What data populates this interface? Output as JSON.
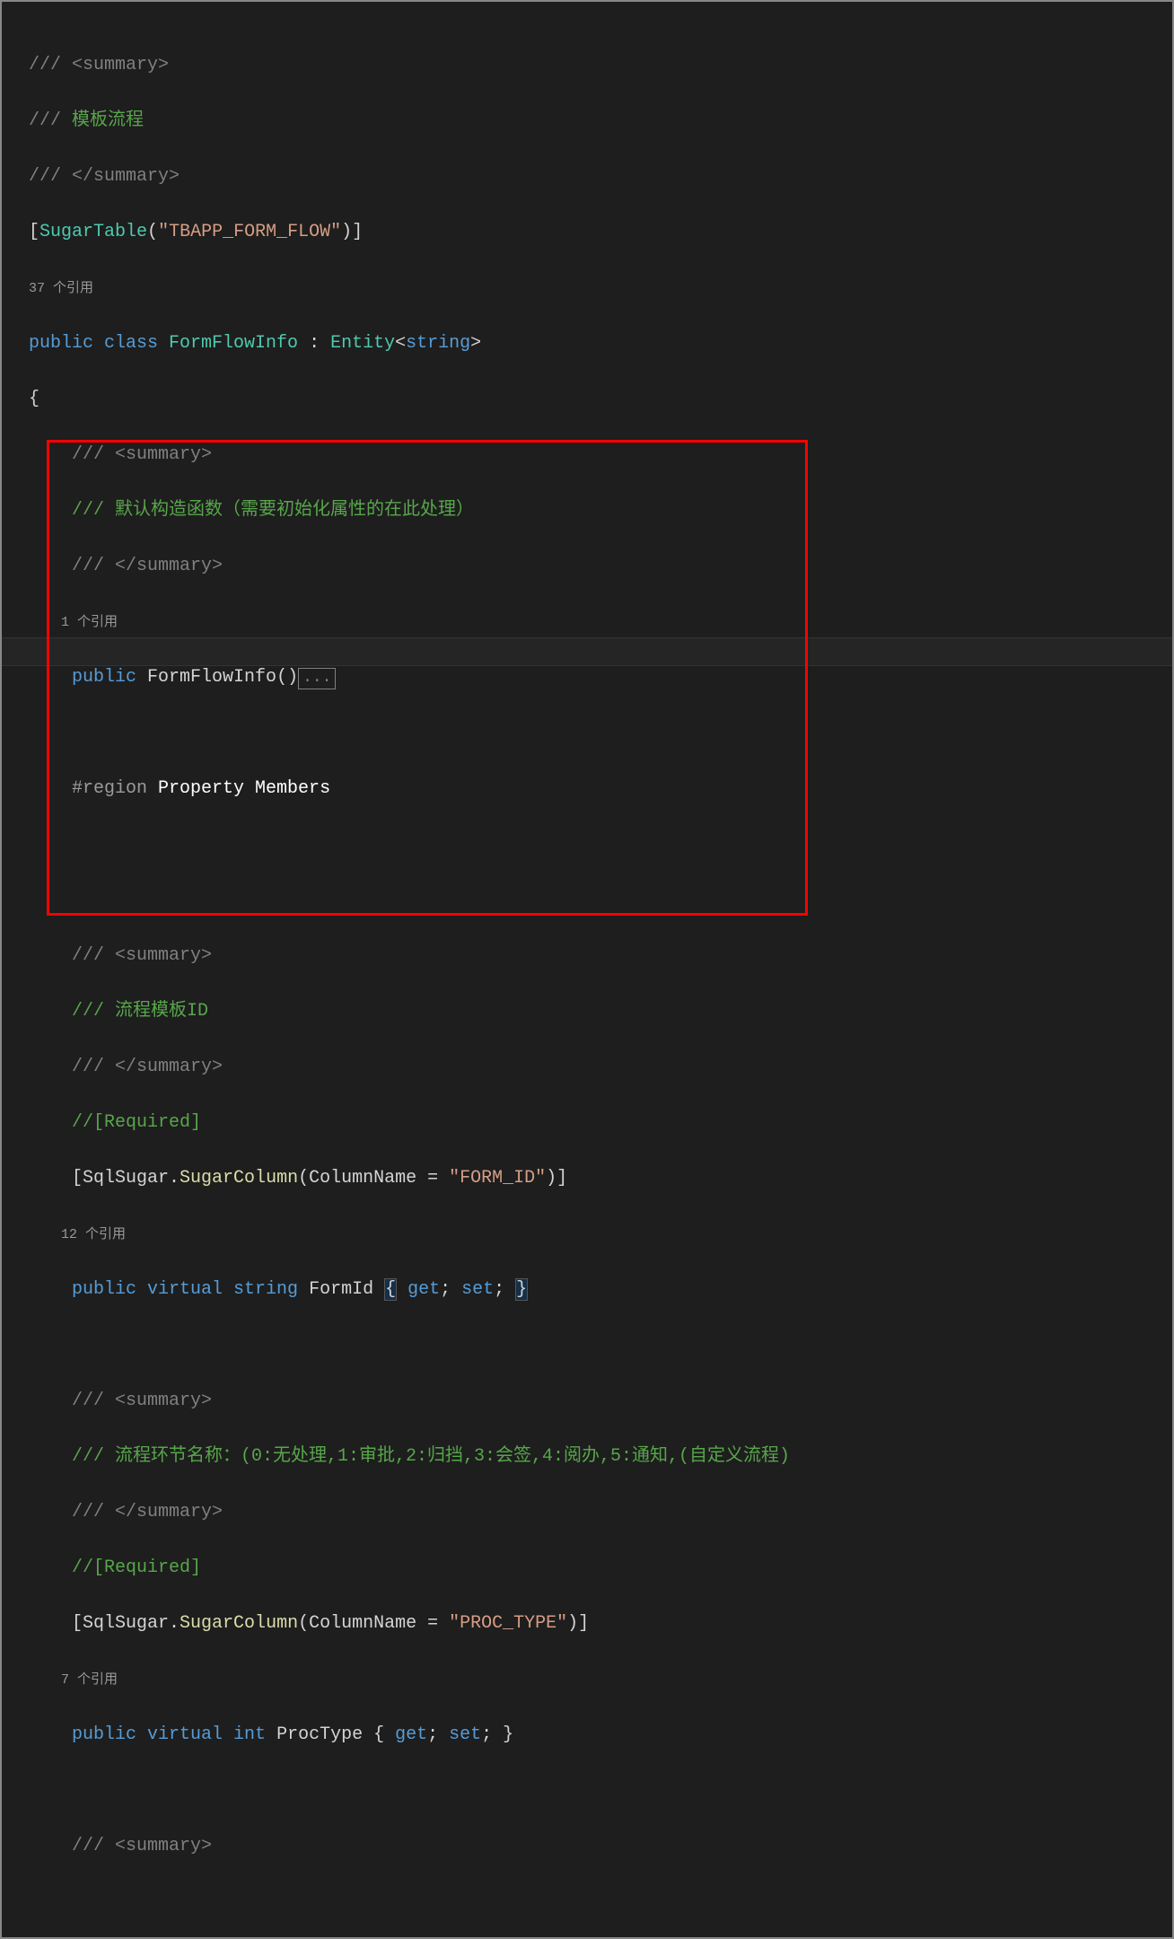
{
  "code": {
    "l1": "/// <summary>",
    "l2_a": "/// ",
    "l2_b": "模板流程",
    "l3": "/// </summary>",
    "l4_b1": "[",
    "l4_type": "SugarTable",
    "l4_p1": "(",
    "l4_str": "\"TBAPP_FORM_FLOW\"",
    "l4_p2": ")]",
    "ref1": "37 个引用",
    "l5_pub": "public",
    "l5_class": " class",
    "l5_name": " FormFlowInfo",
    "l5_colon": " : ",
    "l5_ent": "Entity",
    "l5_lt": "<",
    "l5_str": "string",
    "l5_gt": ">",
    "l6": "{",
    "l7": "    /// <summary>",
    "l8": "    /// 默认构造函数（需要初始化属性的在此处理）",
    "l9": "    /// </summary>",
    "ref2": "    1 个引用",
    "l10_pub": "    public",
    "l10_name": " FormFlowInfo",
    "l10_par": "()",
    "l10_fold": "...",
    "l11": "",
    "l12_region": "    #region",
    "l12_text": " Property Members",
    "l13": "",
    "l14": "",
    "l15": "    /// <summary>",
    "l16": "    /// 流程模板ID",
    "l17": "    /// </summary>",
    "l18": "    //[Required]",
    "l19_b1": "    [",
    "l19_ns": "SqlSugar",
    "l19_dot": ".",
    "l19_sc": "SugarColumn",
    "l19_p1": "(ColumnName = ",
    "l19_str": "\"FORM_ID\"",
    "l19_p2": ")]",
    "ref3": "    12 个引用",
    "l20_pub": "    public",
    "l20_virt": " virtual",
    "l20_str": " string",
    "l20_name": " FormId ",
    "l20_b1": "{",
    "l20_get": " get",
    "l20_sc1": ";",
    "l20_set": " set",
    "l20_sc2": "; ",
    "l20_b2": "}",
    "l21": "",
    "l22": "    /// <summary>",
    "l23": "    /// 流程环节名称：(0:无处理,1:审批,2:归挡,3:会签,4:阅办,5:通知,(自定义流程)",
    "l24": "    /// </summary>",
    "l25": "    //[Required]",
    "l26_b1": "    [",
    "l26_ns": "SqlSugar",
    "l26_dot": ".",
    "l26_sc": "SugarColumn",
    "l26_p1": "(ColumnName = ",
    "l26_str": "\"PROC_TYPE\"",
    "l26_p2": ")]",
    "ref4": "    7 个引用",
    "l27_pub": "    public",
    "l27_virt": " virtual",
    "l27_int": " int",
    "l27_name": " ProcType { ",
    "l27_get": "get",
    "l27_sc1": ";",
    "l27_set": " set",
    "l27_sc2": "; }",
    "l28": "",
    "l29": "    /// <summary>"
  }
}
